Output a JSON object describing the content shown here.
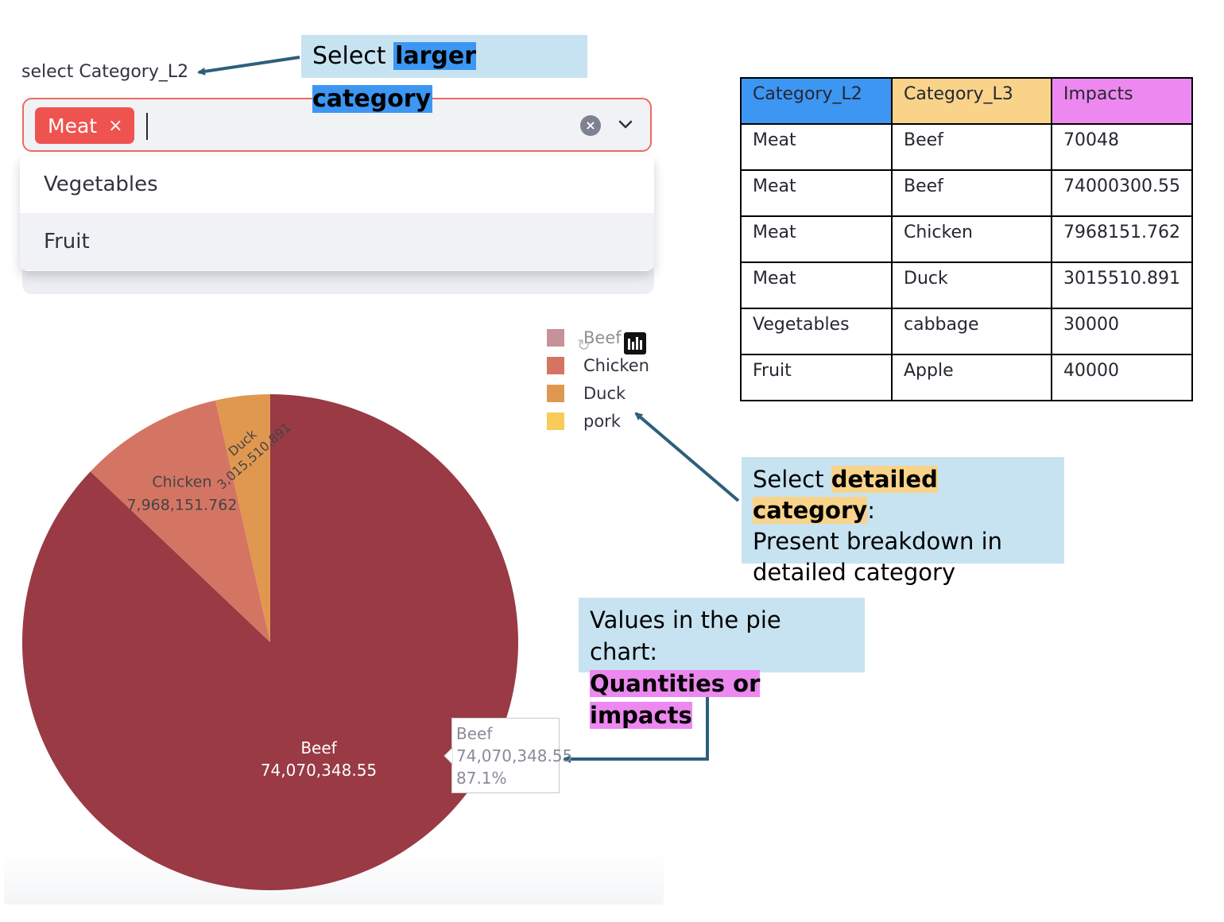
{
  "selector": {
    "label": "select Category_L2",
    "selected_chip": "Meat",
    "chip_remove": "×",
    "clear_symbol": "×",
    "dropdown_options": [
      "Vegetables",
      "Fruit"
    ]
  },
  "callouts": {
    "larger": {
      "prefix": "Select ",
      "highlight": "larger category"
    },
    "detailed": {
      "prefix": "Select ",
      "highlight": "detailed category",
      "suffix": ":",
      "line2": "Present breakdown in",
      "line3": "detailed category"
    },
    "values": {
      "line1": "Values in the pie chart:",
      "highlight": "Quantities or impacts"
    }
  },
  "table": {
    "headers": [
      "Category_L2",
      "Category_L3",
      "Impacts"
    ],
    "rows": [
      [
        "Meat",
        "Beef",
        "70048"
      ],
      [
        "Meat",
        "Beef",
        "74000300.55"
      ],
      [
        "Meat",
        "Chicken",
        "7968151.762"
      ],
      [
        "Meat",
        "Duck",
        "3015510.891"
      ],
      [
        "Vegetables",
        "cabbage",
        "30000"
      ],
      [
        "Fruit",
        "Apple",
        "40000"
      ]
    ],
    "header_colors": [
      "#3c96f2",
      "#f9d38a",
      "#ed88f0"
    ]
  },
  "legend": [
    {
      "label": "Beef",
      "color": "#993a45"
    },
    {
      "label": "Chicken",
      "color": "#d47563"
    },
    {
      "label": "Duck",
      "color": "#e09850"
    },
    {
      "label": "pork",
      "color": "#f8cb5a"
    }
  ],
  "chart_data": {
    "type": "pie",
    "slices": [
      {
        "label": "Beef",
        "value": 74070348.55,
        "display": "74,070,348.55",
        "percent": 87.1,
        "color": "#993a45"
      },
      {
        "label": "Chicken",
        "value": 7968151.762,
        "display": "7,968,151.762",
        "color": "#d47563"
      },
      {
        "label": "Duck",
        "value": 3015510.891,
        "display": "3,015,510.891",
        "color": "#e09850"
      }
    ],
    "tooltip": {
      "label": "Beef",
      "value": "74,070,348.55",
      "percent": "87.1%"
    }
  }
}
